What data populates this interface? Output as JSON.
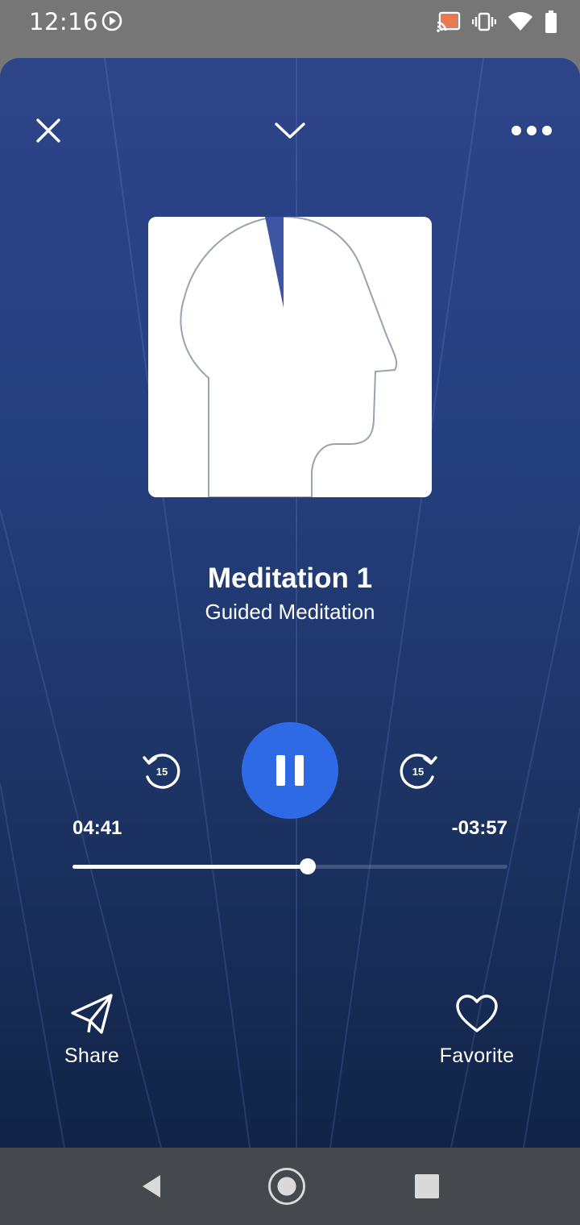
{
  "status_bar": {
    "time": "12:16",
    "icons": [
      "media-play-icon",
      "cast-icon",
      "vibrate-icon",
      "wifi-icon",
      "battery-icon"
    ]
  },
  "header": {
    "close_icon": "close-icon",
    "collapse_icon": "chevron-down-icon",
    "more_icon": "more-horizontal-icon"
  },
  "track": {
    "title": "Meditation 1",
    "subtitle": "Guided Meditation"
  },
  "player": {
    "rewind_seconds": "15",
    "forward_seconds": "15",
    "elapsed": "04:41",
    "remaining": "-03:57",
    "progress_fraction": 0.54,
    "state": "playing"
  },
  "actions": {
    "share_label": "Share",
    "favorite_label": "Favorite"
  },
  "colors": {
    "accent": "#2f6ae6",
    "background_top": "#2d4489",
    "background_bottom": "#112447"
  }
}
